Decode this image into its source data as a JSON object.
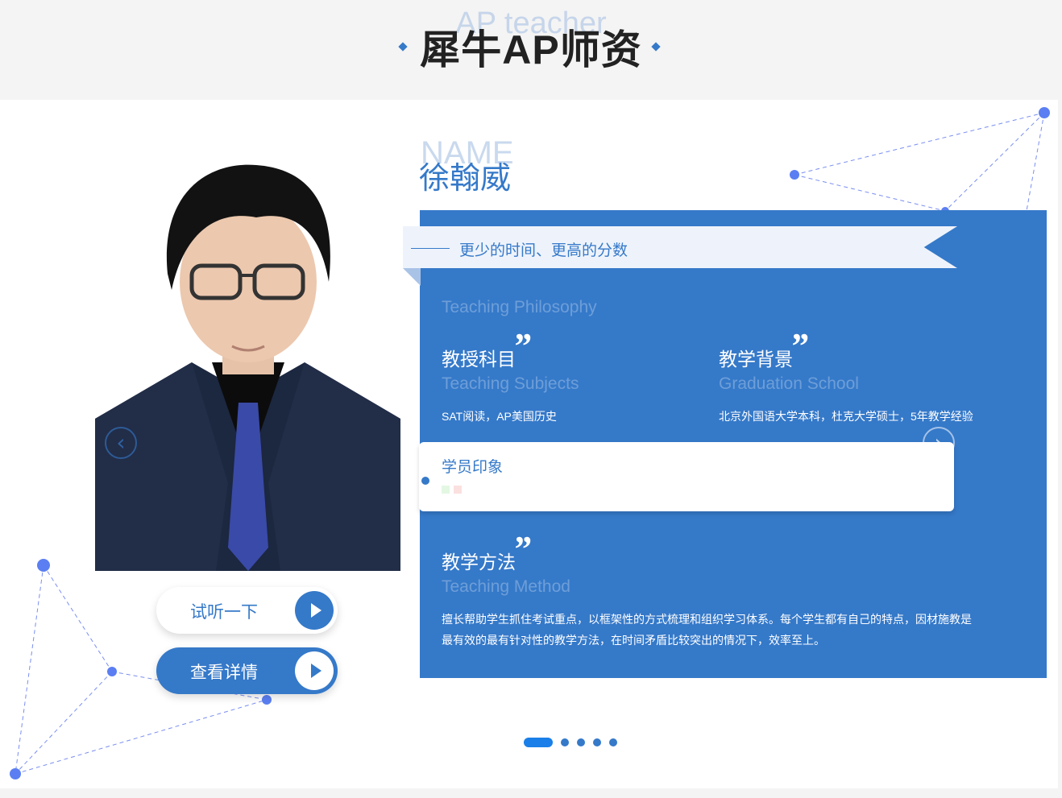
{
  "header": {
    "title": "犀牛AP师资",
    "bg_text": "AP teacher"
  },
  "teacher": {
    "name_bg": "NAME",
    "name": "徐翰威",
    "slogan": "更少的时间、更高的分数",
    "philosophy_en": "Teaching Philosophy",
    "subjects": {
      "heading": "教授科目",
      "en": "Teaching Subjects",
      "value": "SAT阅读，AP美国历史"
    },
    "background": {
      "heading": "教学背景",
      "en": "Graduation School",
      "value": "北京外国语大学本科，杜克大学硕士，5年教学经验"
    },
    "impression": {
      "title": "学员印象"
    },
    "method": {
      "heading": "教学方法",
      "en": "Teaching Method",
      "line1": "擅长帮助学生抓住考试重点，以框架性的方式梳理和组织学习体系。每个学生都有自己的特点，因材施教是",
      "line2": "最有效的最有针对性的教学方法，在时间矛盾比较突出的情况下，效率至上。"
    }
  },
  "quote_mark": "”",
  "buttons": {
    "trial": "试听一下",
    "detail": "查看详情"
  },
  "icons": {
    "prev": "chevron-left-icon",
    "next": "chevron-right-icon",
    "play": "play-icon"
  },
  "arrows": {
    "prev": "‹",
    "next": "›"
  },
  "pagination": {
    "total": 5,
    "active": 1
  },
  "colors": {
    "primary": "#3579c9",
    "active_dot": "#1a7fe8",
    "header_bg": "#f4f4f4"
  }
}
